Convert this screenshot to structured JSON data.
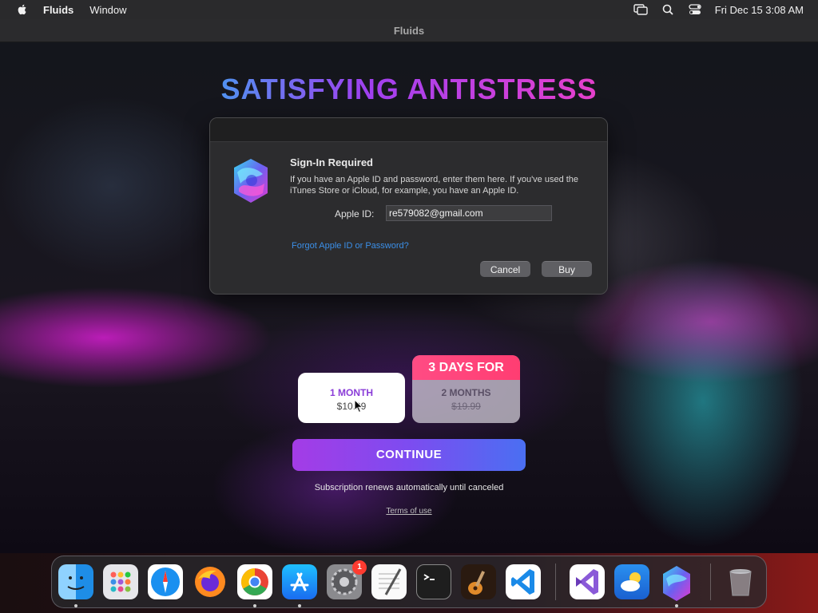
{
  "menubar": {
    "app_name": "Fluids",
    "menus": [
      "Window"
    ],
    "clock": "Fri Dec 15  3:08 AM",
    "icons": [
      "apple-icon",
      "screen-mirroring-icon",
      "search-icon",
      "control-center-icon"
    ]
  },
  "window": {
    "title": "Fluids"
  },
  "game": {
    "headline": "SATISFYING ANTISTRESS",
    "plans": [
      {
        "name": "1 MONTH",
        "price": "$10.99",
        "selected": true
      },
      {
        "badge": "3 DAYS FOR",
        "name": "2 MONTHS",
        "price": "$19.99",
        "selected": false
      }
    ],
    "continue_label": "CONTINUE",
    "renew_text": "Subscription renews automatically until canceled",
    "terms_text": "Terms of use"
  },
  "dialog": {
    "title": "Sign-In Required",
    "message": "If you have an Apple ID and password, enter them here. If you've used the iTunes Store or iCloud, for example, you have an Apple ID.",
    "apple_id_label": "Apple ID:",
    "apple_id_value": "re579082@gmail.com",
    "forgot_link": "Forgot Apple ID or Password?",
    "cancel_label": "Cancel",
    "buy_label": "Buy"
  },
  "dock": {
    "apps": [
      "Finder",
      "Launchpad",
      "Safari",
      "Firefox",
      "Chrome",
      "App Store",
      "System Settings",
      "TextEdit",
      "Terminal",
      "GarageBand",
      "Visual Studio Code",
      "Visual Studio",
      "Weather",
      "Fluids",
      "Trash"
    ],
    "system_settings_badge": "1",
    "colors": {
      "accent": "#3b8fe8",
      "badge": "#ff3b30"
    }
  }
}
